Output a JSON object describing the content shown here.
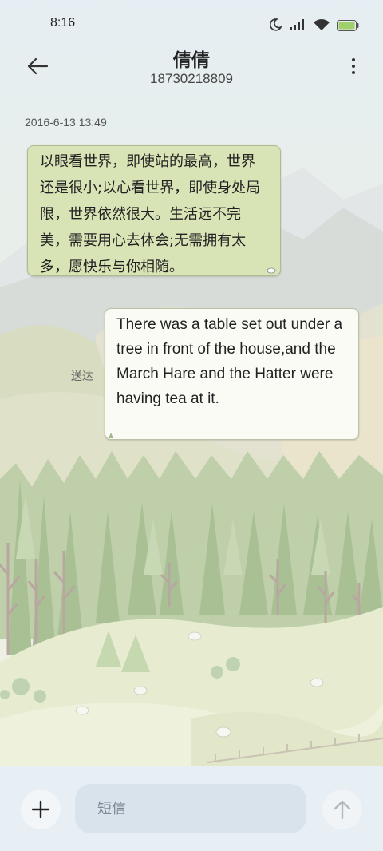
{
  "status_bar": {
    "time": "8:16",
    "icons": [
      "moon-icon",
      "signal-icon",
      "wifi-icon",
      "battery-icon"
    ]
  },
  "header": {
    "back_icon": "back-arrow-icon",
    "contact_name": "倩倩",
    "contact_number": "18730218809",
    "more_icon": "more-vertical-icon"
  },
  "conversation": {
    "timestamp": "2016-6-13 13:49",
    "messages": [
      {
        "direction": "incoming",
        "text": "以眼看世界，即使站的最高，世界还是很小;以心看世界，即使身处局限，世界依然很大。生活远不完美，需要用心去体会;无需拥有太多，愿快乐与你相随。"
      },
      {
        "direction": "outgoing",
        "text": "There was a table set out under a tree in front of the house,and the March Hare and the Hatter were having tea at it.",
        "status": "送达"
      }
    ]
  },
  "input_bar": {
    "add_icon": "plus-icon",
    "placeholder": "短信",
    "send_icon": "send-arrow-icon"
  },
  "colors": {
    "incoming_bubble": "#d8e4b6",
    "outgoing_bubble": "#fbfbf6",
    "input_bar": "#e7eef4"
  }
}
